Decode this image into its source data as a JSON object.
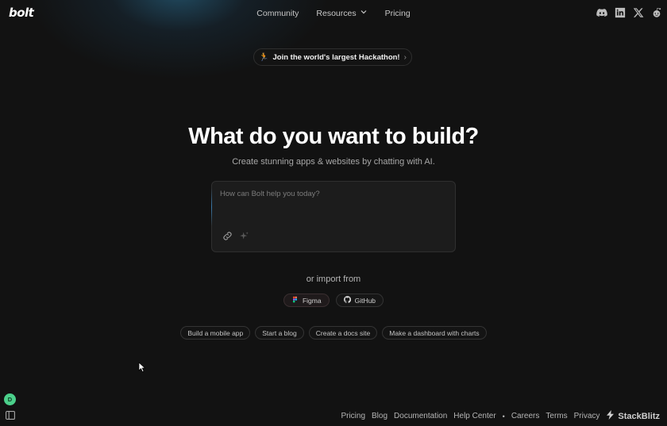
{
  "header": {
    "logo": "bolt",
    "nav": {
      "community": "Community",
      "resources": "Resources",
      "pricing": "Pricing"
    },
    "social_icons": [
      "discord-icon",
      "linkedin-icon",
      "x-icon",
      "reddit-icon"
    ]
  },
  "banner": {
    "text": "Join the world's largest Hackathon!",
    "emoji": "🏃",
    "chevron": "›"
  },
  "hero": {
    "title": "What do you want to build?",
    "subtitle": "Create stunning apps & websites by chatting with AI."
  },
  "prompt": {
    "placeholder": "How can Bolt help you today?",
    "value": ""
  },
  "import": {
    "label": "or import from",
    "sources": [
      {
        "label": "Figma",
        "icon": "figma-icon"
      },
      {
        "label": "GitHub",
        "icon": "github-icon"
      }
    ]
  },
  "suggestions": [
    "Build a mobile app",
    "Start a blog",
    "Create a docs site",
    "Make a dashboard with charts"
  ],
  "user": {
    "avatar_initial": "D"
  },
  "footer": {
    "links": [
      "Pricing",
      "Blog",
      "Documentation",
      "Help Center"
    ],
    "separator": "•",
    "links2": [
      "Careers",
      "Terms",
      "Privacy"
    ],
    "brand": "StackBlitz"
  },
  "colors": {
    "background": "#121212",
    "avatar": "#4bd08b",
    "accent_glow": "#2c78a0"
  }
}
